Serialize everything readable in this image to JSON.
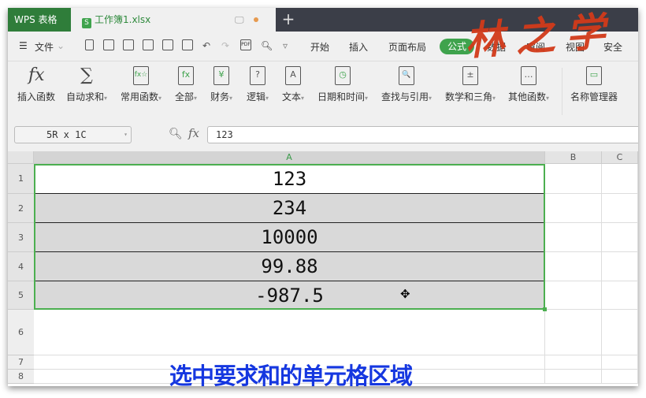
{
  "tabs": {
    "app": "WPS 表格",
    "doc_icon": "S",
    "document": "工作簿1.xlsx",
    "new_tab": "+"
  },
  "menu": {
    "file": "文件",
    "items": [
      "开始",
      "插入",
      "页面布局",
      "公式",
      "数据",
      "审阅",
      "视图",
      "安全"
    ],
    "active": "公式"
  },
  "ribbon": [
    {
      "label": "插入函数",
      "icon": "fx",
      "dropdown": false
    },
    {
      "label": "自动求和",
      "icon": "∑",
      "dropdown": true
    },
    {
      "label": "常用函数",
      "icon": "fx☆",
      "dropdown": true
    },
    {
      "label": "全部",
      "icon": "fx",
      "dropdown": true
    },
    {
      "label": "财务",
      "icon": "¥",
      "dropdown": true
    },
    {
      "label": "逻辑",
      "icon": "?",
      "dropdown": true
    },
    {
      "label": "文本",
      "icon": "A",
      "dropdown": true
    },
    {
      "label": "日期和时间",
      "icon": "◷",
      "dropdown": true
    },
    {
      "label": "查找与引用",
      "icon": "🔍",
      "dropdown": true
    },
    {
      "label": "数学和三角",
      "icon": "±",
      "dropdown": true
    },
    {
      "label": "其他函数",
      "icon": "…",
      "dropdown": true
    },
    {
      "label": "名称管理器",
      "icon": "▭",
      "dropdown": false
    }
  ],
  "formula_bar": {
    "name_box": "5R x 1C",
    "fx": "fx",
    "value": "123"
  },
  "sheet": {
    "columns": [
      "A",
      "B",
      "C"
    ],
    "rows": [
      "1",
      "2",
      "3",
      "4",
      "5",
      "6",
      "7",
      "8"
    ],
    "values": [
      "123",
      "234",
      "10000",
      "99.88",
      "-987.5"
    ]
  },
  "caption": "选中要求和的单元格区域",
  "watermark": "林之学",
  "colors": {
    "accent": "#3fa34d",
    "selection": "#4caf50",
    "caption": "#1537e0"
  }
}
